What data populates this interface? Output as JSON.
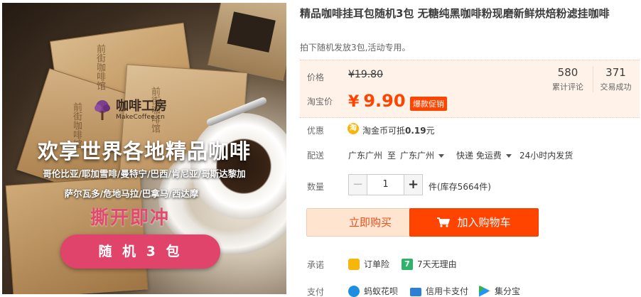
{
  "product_image": {
    "brand_name": "咖啡工房",
    "brand_site": "MakeCoffee.cn",
    "headline": "欢享世界各地精品咖啡",
    "origins_line1": "哥伦比亚/耶加雪啡/曼特宁/巴西/肯尼亚/哥斯达黎加",
    "origins_line2": "萨尔瓦多/危地马拉/巴拿马/西达摩",
    "tear_text": "撕开即冲",
    "random_label": "随 机 3 包",
    "bag_text_1": "前街咖啡馆",
    "bag_text_2": "前街咖啡馆",
    "bag_text_3": "前街咖啡馆"
  },
  "product": {
    "title": "精品咖啡挂耳包随机3包 无糖纯黑咖啡粉现磨新鲜烘焙粉滤挂咖啡",
    "subtitle": "拍下随机发放3包,活动专用。"
  },
  "price": {
    "price_label": "价格",
    "original_price": "¥19.80",
    "taobao_label": "淘宝价",
    "currency": "¥",
    "current_price": "9.90",
    "promo_badge": "爆款促销",
    "reviews_count": "580",
    "reviews_label": "累计评论",
    "sales_count": "371",
    "sales_label": "交易成功"
  },
  "discount": {
    "label": "优惠",
    "coin_glyph": "淘",
    "text_prefix": "淘金币可抵",
    "amount": "0.19",
    "text_suffix": "元"
  },
  "shipping": {
    "label": "配送",
    "from": "广东广州",
    "to_word": "至",
    "to": "广东广州",
    "method": "快递 免运费",
    "dispatch": "24小时内发货"
  },
  "quantity": {
    "label": "数量",
    "minus": "−",
    "value": "1",
    "plus": "+",
    "stock": "件(库存5664件)"
  },
  "actions": {
    "buy_now": "立即购买",
    "add_to_cart": "加入购物车"
  },
  "promise": {
    "label": "承诺",
    "item1": "订单险",
    "item2_icon_text": "7",
    "item2": "7天无理由"
  },
  "payment": {
    "label": "支付",
    "item1": "蚂蚁花呗",
    "item2": "信用卡支付",
    "item3": "集分宝"
  },
  "colors": {
    "accent": "#ff4400",
    "price": "#ff4400",
    "price_bg": "#fff2e8",
    "pill": "#e0446a"
  }
}
